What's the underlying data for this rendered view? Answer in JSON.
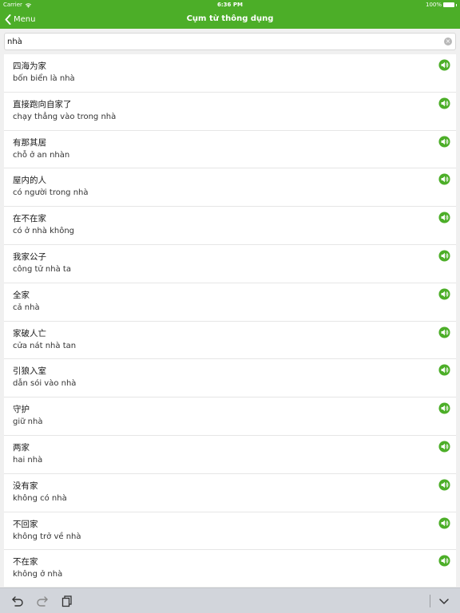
{
  "status_bar": {
    "carrier": "Carrier",
    "time": "6:36 PM",
    "battery": "100%"
  },
  "nav": {
    "back_label": "Menu",
    "title": "Cụm từ thông dụng",
    "bar_color": "#4cae28"
  },
  "search": {
    "value": "nhà",
    "clear_icon": "clear-icon"
  },
  "phrases": [
    {
      "zh": "四海为家",
      "vi": "bốn biển là nhà"
    },
    {
      "zh": "直接跑向自家了",
      "vi": "chạy thẳng vào trong nhà"
    },
    {
      "zh": "有那其居",
      "vi": "chỗ ở an nhàn"
    },
    {
      "zh": "屋内的人",
      "vi": "có người trong nhà"
    },
    {
      "zh": "在不在家",
      "vi": "có ở nhà không"
    },
    {
      "zh": "我家公子",
      "vi": "công tử nhà ta"
    },
    {
      "zh": "全家",
      "vi": "cả nhà"
    },
    {
      "zh": "家破人亡",
      "vi": "cửa nát nhà tan"
    },
    {
      "zh": "引狼入室",
      "vi": "dẫn sói vào nhà"
    },
    {
      "zh": "守护",
      "vi": "giữ nhà"
    },
    {
      "zh": "两家",
      "vi": "hai nhà"
    },
    {
      "zh": "没有家",
      "vi": "không có nhà"
    },
    {
      "zh": "不回家",
      "vi": "không trở về nhà"
    },
    {
      "zh": "不在家",
      "vi": "không ở nhà"
    }
  ],
  "toolbar": {
    "icons": [
      "undo-icon",
      "redo-icon",
      "paste-icon",
      "hide-keyboard-icon"
    ]
  },
  "colors": {
    "accent": "#4cae28",
    "speaker": "#4cae28"
  }
}
